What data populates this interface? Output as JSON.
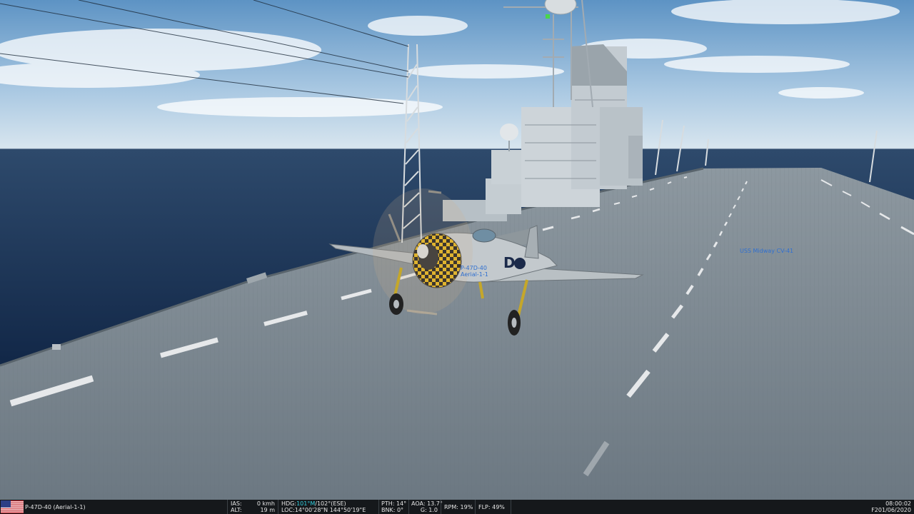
{
  "scene": {
    "ship_label": "USS Midway CV-41",
    "aircraft_label_line1": "P-47D-40",
    "aircraft_label_line2": "Aerial-1-1"
  },
  "statusbar": {
    "flag_icon": "us-flag-icon",
    "aircraft": "P-47D-40 (Aerial-1-1)",
    "ias_label": "IAS:",
    "ias_value": "0",
    "ias_unit": "kmh",
    "alt_label": "ALT:",
    "alt_value": "19",
    "alt_unit": "m",
    "hdg_label": "HDG:",
    "hdg_mag": "101°M",
    "hdg_rest": "/102°(ESE)",
    "loc_label": "LOC:",
    "loc_value": "14°00'28\"N 144°50'19\"E",
    "pth_label": "PTH:",
    "pth_value": "14°",
    "bnk_label": "BNK:",
    "bnk_value": "0°",
    "aoa_label": "AOA:",
    "aoa_value": "13.7°",
    "g_label": "G:",
    "g_value": "1.0",
    "rpm_label": "RPM:",
    "rpm_value": "19%",
    "flp_label": "FLP:",
    "flp_value": "49%",
    "time": "08:00:02",
    "date": "F201/06/2020"
  },
  "colors": {
    "label_blue": "#2f6fd0",
    "status_bg": "#15181b",
    "heading_cyan": "#33d0e0"
  }
}
